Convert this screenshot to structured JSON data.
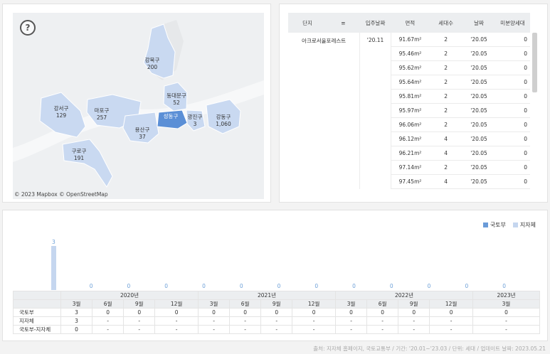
{
  "map": {
    "help_icon": "?",
    "attribution": "© 2023 Mapbox © OpenStreetMap",
    "districts": [
      {
        "name": "강북구",
        "value": "200"
      },
      {
        "name": "동대문구",
        "value": "52"
      },
      {
        "name": "강서구",
        "value": "129"
      },
      {
        "name": "마포구",
        "value": "257"
      },
      {
        "name": "성동구",
        "value": "",
        "selected": true
      },
      {
        "name": "광진구",
        "value": "3"
      },
      {
        "name": "강동구",
        "value": "1,060"
      },
      {
        "name": "용산구",
        "value": "37"
      },
      {
        "name": "구로구",
        "value": "191"
      }
    ],
    "colors": {
      "fill": "#c9d9f1",
      "selected": "#5b8fd6",
      "background": "#eef0f2"
    }
  },
  "apartment_table": {
    "headers": [
      "단지",
      "입주날짜",
      "면적",
      "세대수",
      "날짜",
      "미분양세대"
    ],
    "sort_icon": "sort-icon",
    "complex": "아크로서울포레스트",
    "move_in": "'20.11",
    "rows": [
      {
        "area": "91.67m²",
        "units": "2",
        "date": "'20.05",
        "unsold": "0"
      },
      {
        "area": "95.46m²",
        "units": "2",
        "date": "'20.05",
        "unsold": "0"
      },
      {
        "area": "95.62m²",
        "units": "2",
        "date": "'20.05",
        "unsold": "0"
      },
      {
        "area": "95.64m²",
        "units": "2",
        "date": "'20.05",
        "unsold": "0"
      },
      {
        "area": "95.81m²",
        "units": "2",
        "date": "'20.05",
        "unsold": "0"
      },
      {
        "area": "95.97m²",
        "units": "2",
        "date": "'20.05",
        "unsold": "0"
      },
      {
        "area": "96.06m²",
        "units": "2",
        "date": "'20.05",
        "unsold": "0"
      },
      {
        "area": "96.12m²",
        "units": "4",
        "date": "'20.05",
        "unsold": "0"
      },
      {
        "area": "96.21m²",
        "units": "4",
        "date": "'20.05",
        "unsold": "0"
      },
      {
        "area": "97.14m²",
        "units": "2",
        "date": "'20.05",
        "unsold": "0"
      },
      {
        "area": "97.45m²",
        "units": "4",
        "date": "'20.05",
        "unsold": "0"
      }
    ]
  },
  "chart_data": {
    "type": "bar",
    "legend": [
      "국토부",
      "지자체"
    ],
    "legend_colors": [
      "#6a9bd8",
      "#c5d6ef"
    ],
    "years": [
      {
        "label": "2020년",
        "span": 4
      },
      {
        "label": "2021년",
        "span": 4
      },
      {
        "label": "2022년",
        "span": 4
      },
      {
        "label": "2023년",
        "span": 1
      }
    ],
    "months": [
      "3월",
      "6월",
      "9월",
      "12월",
      "3월",
      "6월",
      "9월",
      "12월",
      "3월",
      "6월",
      "9월",
      "12월",
      "3월"
    ],
    "bar_labels": [
      "3",
      "0",
      "0",
      "0",
      "0",
      "0",
      "0",
      "0",
      "0",
      "0",
      "0",
      "0",
      "0"
    ],
    "series": [
      {
        "name": "국토부",
        "values": [
          3,
          0,
          0,
          0,
          0,
          0,
          0,
          0,
          0,
          0,
          0,
          0,
          0
        ]
      },
      {
        "name": "지자체",
        "values": [
          3,
          null,
          null,
          null,
          null,
          null,
          null,
          null,
          null,
          null,
          null,
          null,
          null
        ]
      }
    ],
    "ylim": [
      0,
      3
    ]
  },
  "chart_table": {
    "rows": [
      {
        "label": "국토부",
        "cells": [
          "3",
          "0",
          "0",
          "0",
          "0",
          "0",
          "0",
          "0",
          "0",
          "0",
          "0",
          "0",
          "0"
        ]
      },
      {
        "label": "지자체",
        "cells": [
          "3",
          "-",
          "-",
          "-",
          "-",
          "-",
          "-",
          "-",
          "-",
          "-",
          "-",
          "-",
          "-"
        ]
      },
      {
        "label": "국토부-지자체",
        "cells": [
          "0",
          "-",
          "-",
          "-",
          "-",
          "-",
          "-",
          "-",
          "-",
          "-",
          "-",
          "-",
          "-"
        ]
      }
    ]
  },
  "footnote": "출처: 지자체 홈페이지, 국토교통부 / 기간: '20.01~'23.03 / 단위: 세대 / 업데이트 날짜: 2023.05.21"
}
